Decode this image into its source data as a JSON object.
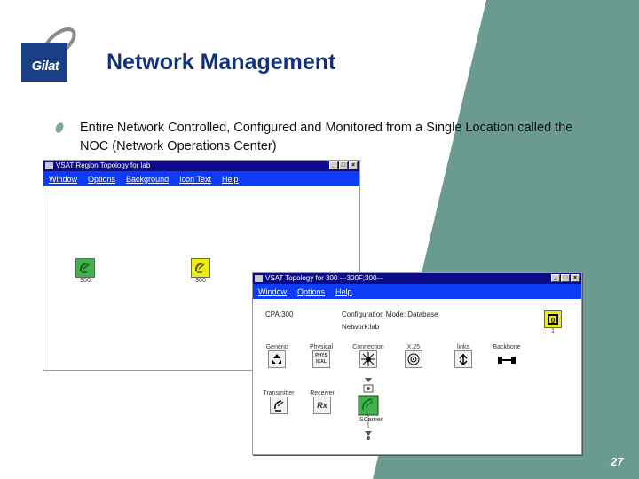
{
  "slide": {
    "title": "Network Management",
    "bullet": "Entire Network Controlled, Configured and Monitored from a Single Location called the NOC (Network Operations Center)",
    "page_number": "27",
    "logo_text": "Gilat"
  },
  "colors": {
    "accent_teal": "#6b9a90",
    "title_blue": "#13307a",
    "window_title_bg": "#0c0c86",
    "menu_bg": "#0c3cf6",
    "node_green": "#3fb34a",
    "node_yellow": "#ecec1a"
  },
  "window1": {
    "title": "VSAT Region Topology for lab",
    "menu": [
      "Window",
      "Options",
      "Background",
      "Icon Text",
      "Help"
    ],
    "nodes": [
      {
        "label": "300",
        "status": "green",
        "icon": "satellite-dish-icon"
      },
      {
        "label": "300",
        "status": "yellow",
        "icon": "satellite-dish-icon"
      }
    ]
  },
  "window2": {
    "title": "VSAT Topology for 300 ---300F;300---",
    "menu": [
      "Window",
      "Options",
      "Help"
    ],
    "info": {
      "left": "CPA:300",
      "config_label": "Configuration Mode: Database",
      "network": "Network:lab"
    },
    "status_counter": "1",
    "components": [
      {
        "label": "Generic",
        "icon": "generic-icon"
      },
      {
        "label": "Physical",
        "sublabel": "PHYS ICAL",
        "icon": "physical-icon"
      },
      {
        "label": "Connection",
        "icon": "connection-icon"
      },
      {
        "label": "X.25",
        "icon": "x25-icon"
      },
      {
        "label": "links",
        "icon": "links-icon"
      },
      {
        "label": "Backbone",
        "icon": "backbone-icon"
      },
      {
        "label": "Transmitter",
        "icon": "transmitter-icon"
      },
      {
        "label": "Receiver",
        "sublabel": "Rx",
        "icon": "receiver-icon"
      },
      {
        "label": "SCarrier",
        "icon": "satellite-carrier-icon"
      }
    ]
  }
}
